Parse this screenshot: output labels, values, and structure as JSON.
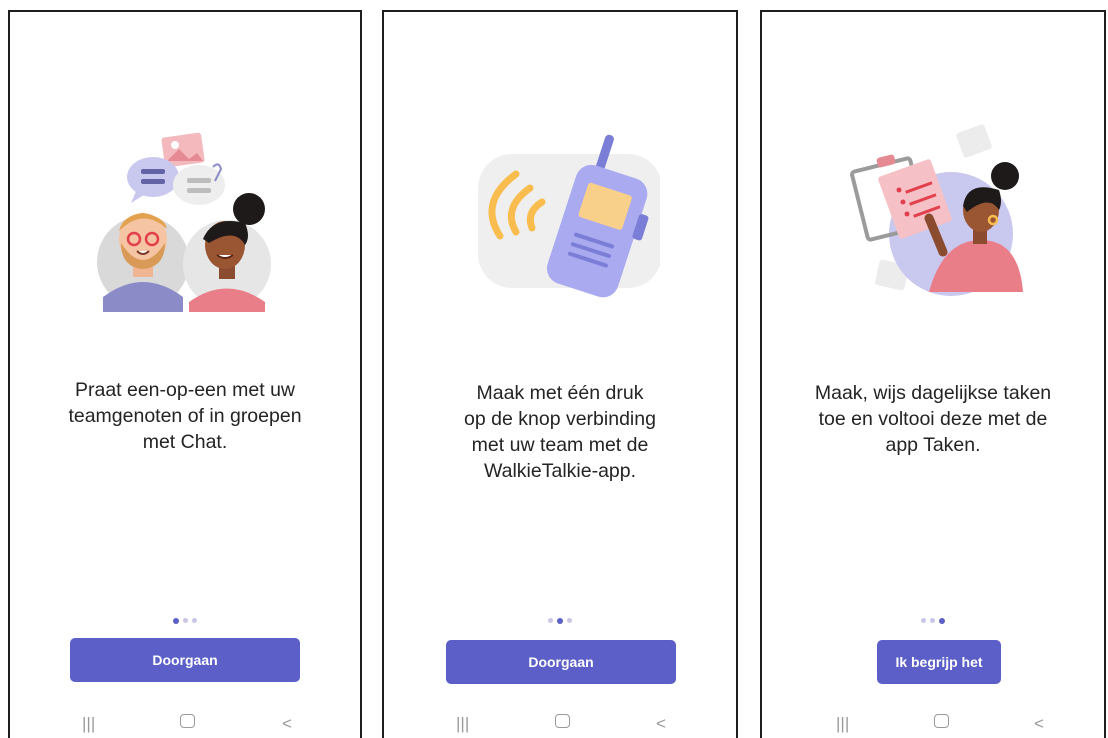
{
  "screens": [
    {
      "caption": "Praat een-op-een met uw\nteamgenoten of in groepen\nmet Chat.",
      "button_label": "Doorgaan",
      "active_dot": 0,
      "illustration_icon": "chat-people-icon"
    },
    {
      "caption": "Maak met één druk\nop de knop verbinding\nmet uw team met de\nWalkieTalkie-app.",
      "button_label": "Doorgaan",
      "active_dot": 1,
      "illustration_icon": "walkie-talkie-icon"
    },
    {
      "caption": "Maak, wijs dagelijkse taken\ntoe en voltooi deze met de\napp Taken.",
      "button_label": "Ik begrijp het",
      "active_dot": 2,
      "illustration_icon": "tasks-clipboard-icon"
    }
  ],
  "nav": {
    "recents_icon": "recents-icon",
    "home_icon": "home-icon",
    "back_icon": "back-icon"
  },
  "colors": {
    "accent": "#5b5fc7",
    "dot_inactive": "#c8c6e6",
    "text": "#242424"
  }
}
